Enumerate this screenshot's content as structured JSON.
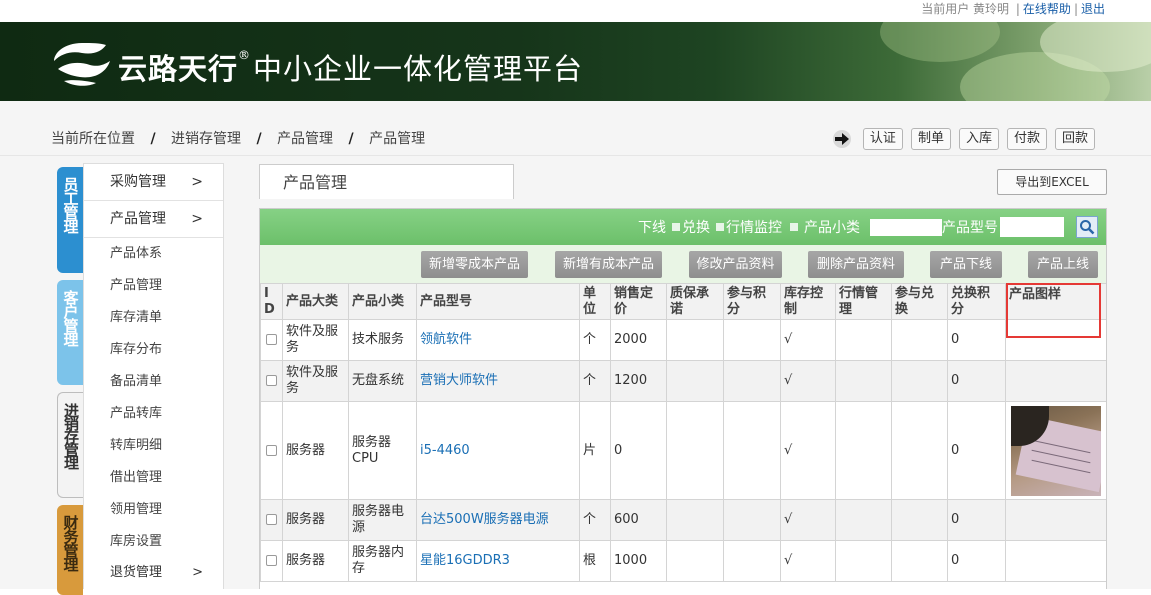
{
  "userbar": {
    "current_user_label": "当前用户",
    "user_name": "黄玲明",
    "help": "在线帮助",
    "logout": "退出",
    "sep": "|"
  },
  "brand": {
    "name": "云路天行",
    "reg": "®",
    "subtitle": "中小企业一体化管理平台"
  },
  "breadcrumb": {
    "items": [
      "当前所在位置",
      "进销存管理",
      "产品管理",
      "产品管理"
    ],
    "sep": "/"
  },
  "actions": [
    "认证",
    "制单",
    "入库",
    "付款",
    "回款"
  ],
  "vtabs": [
    "员工管理",
    "客户管理",
    "进销存管理",
    "财务管理"
  ],
  "sidebar": {
    "group1": "采购管理",
    "group2": "产品管理",
    "chevron": ">",
    "items": [
      "产品体系",
      "产品管理",
      "库存清单",
      "库存分布",
      "备品清单",
      "产品转库",
      "转库明细",
      "借出管理",
      "领用管理",
      "库房设置",
      "退货管理"
    ]
  },
  "panel": {
    "title": "产品管理",
    "export": "导出到EXCEL"
  },
  "filter": {
    "offline": "下线",
    "exchange": "兑换",
    "monitor": "行情监控",
    "subcat": "产品小类",
    "model": "产品型号"
  },
  "toolbar": [
    "新增零成本产品",
    "新增有成本产品",
    "修改产品资料",
    "删除产品资料",
    "产品下线",
    "产品上线"
  ],
  "table": {
    "headers": [
      "ID",
      "产品大类",
      "产品小类",
      "产品型号",
      "单位",
      "销售定价",
      "质保承诺",
      "参与积分",
      "库存控制",
      "行情管理",
      "参与兑换",
      "兑换积分",
      "产品图样"
    ],
    "rows": [
      {
        "cat": "软件及服务",
        "sub": "技术服务",
        "model": "领航软件",
        "unit": "个",
        "price": "2000",
        "stock": "√",
        "points": "0",
        "image": false
      },
      {
        "cat": "软件及服务",
        "sub": "无盘系统",
        "model": "营销大师软件",
        "unit": "个",
        "price": "1200",
        "stock": "√",
        "points": "0",
        "image": false
      },
      {
        "cat": "服务器",
        "sub": "服务器CPU",
        "model": "i5-4460",
        "unit": "片",
        "price": "0",
        "stock": "√",
        "points": "0",
        "image": true
      },
      {
        "cat": "服务器",
        "sub": "服务器电源",
        "model": "台达500W服务器电源",
        "unit": "个",
        "price": "600",
        "stock": "√",
        "points": "0",
        "image": false
      },
      {
        "cat": "服务器",
        "sub": "服务器内存",
        "model": "星能16GDDR3",
        "unit": "根",
        "price": "1000",
        "stock": "√",
        "points": "0",
        "image": false
      }
    ]
  },
  "colors": {
    "tab_blue": "#2c8fd0",
    "tab_lightblue": "#7cc3ea",
    "tab_gray": "#c8c8c8",
    "tab_orange": "#d89a3c",
    "filter_green": "#6cc06a",
    "highlight": "#e53935"
  }
}
